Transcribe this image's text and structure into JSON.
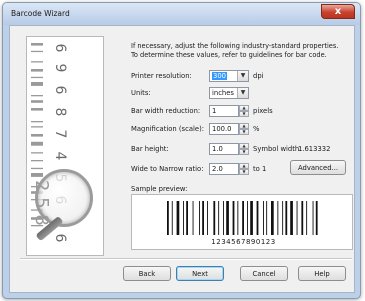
{
  "window": {
    "title": "Barcode Wizard",
    "close_glyph": "x"
  },
  "instructions": [
    "If necessary, adjust the following industry-standard properties.",
    "To determine these values, refer to guidelines for bar code."
  ],
  "fields": {
    "printer_resolution": {
      "label": "Printer resolution:",
      "value": "300",
      "unit": "dpi"
    },
    "units": {
      "label": "Units:",
      "value": "inches"
    },
    "bar_width_reduction": {
      "label": "Bar width reduction:",
      "value": "1",
      "unit": "pixels"
    },
    "magnification": {
      "label": "Magnification (scale):",
      "value": "100.0",
      "unit": "%"
    },
    "bar_height": {
      "label": "Bar height:",
      "value": "1.0",
      "symbol_width_label": "Symbol width:",
      "symbol_width_value": "1.613332"
    },
    "wide_narrow": {
      "label": "Wide to Narrow ratio:",
      "value": "2.0",
      "unit": "to 1"
    }
  },
  "advanced_label": "Advanced...",
  "sample_preview_label": "Sample preview:",
  "barcode_text": "1234567890123",
  "side_digits": [
    "6",
    "9",
    "6",
    "8",
    "7",
    "4",
    "5",
    "6",
    "6"
  ],
  "side_mag_text": "2 5 8",
  "buttons": {
    "back": "Back",
    "next": "Next",
    "cancel": "Cancel",
    "help": "Help"
  },
  "icons": {
    "dropdown": "chevron-down-icon",
    "spin": "spinner-icon",
    "magnifier": "magnifier-icon",
    "close": "close-icon"
  }
}
